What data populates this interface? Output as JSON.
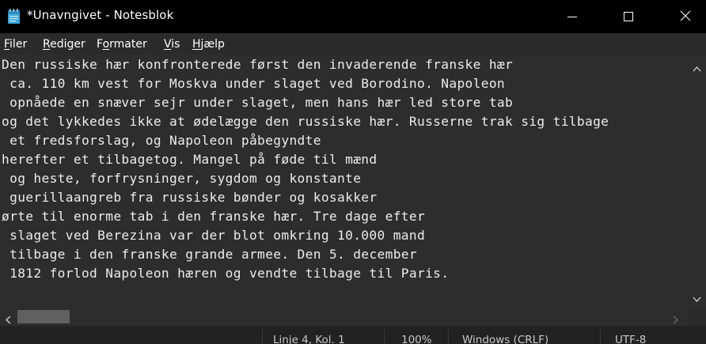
{
  "window": {
    "title": "*Unavngivet - Notesblok",
    "icon": "notepad-icon",
    "controls": [
      "minimize-icon",
      "maximize-icon",
      "close-icon"
    ]
  },
  "menu": {
    "items": [
      {
        "label": "Filer",
        "accel": "F",
        "rest": "iler"
      },
      {
        "label": "Rediger",
        "accel": "R",
        "rest": "ediger"
      },
      {
        "label": "Formater",
        "pre": "F",
        "accel": "o",
        "rest": "rmater"
      },
      {
        "label": "Vis",
        "accel": "V",
        "rest": "is"
      },
      {
        "label": "Hjælp",
        "accel": "H",
        "rest": "jælp"
      }
    ]
  },
  "editor": {
    "lines": [
      "Den russiske hær konfronterede først den invaderende franske hær",
      " ca. 110 km vest for Moskva under slaget ved Borodino. Napoleon",
      " opnåede en snæver sejr under slaget, men hans hær led store tab",
      "og det lykkedes ikke at ødelægge den russiske hær. Russerne trak sig tilbage",
      " et fredsforslag, og Napoleon påbegyndte",
      "herefter et tilbagetog. Mangel på føde til mænd",
      " og heste, forfrysninger, sygdom og konstante",
      " guerillaangreb fra russiske bønder og kosakker",
      "ørte til enorme tab i den franske hær. Tre dage efter",
      " slaget ved Berezina var der blot omkring 10.000 mand",
      " tilbage i den franske grande armee. Den 5. december",
      " 1812 forlod Napoleon hæren og vendte tilbage til Paris."
    ]
  },
  "status": {
    "position": "Linje 4, Kol. 1",
    "zoom": "100%",
    "line_endings": "Windows (CRLF)",
    "encoding": "UTF-8"
  },
  "colors": {
    "titlebar": "#000000",
    "editor_bg": "#2d2d2d",
    "text": "#ececec"
  }
}
